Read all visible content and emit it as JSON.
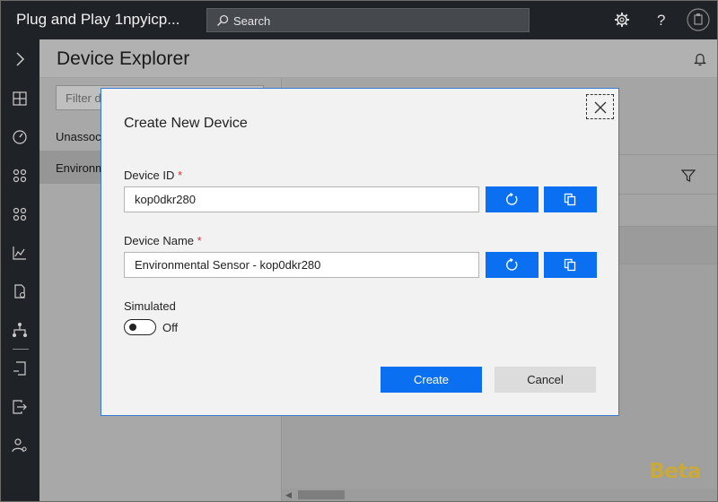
{
  "app": {
    "title": "Plug and Play 1npyicp..."
  },
  "search": {
    "placeholder": "Search"
  },
  "page": {
    "title": "Device Explorer"
  },
  "list": {
    "filter_placeholder": "Filter d",
    "items": [
      {
        "label": "Unassoci",
        "selected": false
      },
      {
        "label": "Environm",
        "selected": true
      }
    ]
  },
  "dialog": {
    "title": "Create New Device",
    "device_id": {
      "label": "Device ID",
      "required_mark": "*",
      "value": "kop0dkr280"
    },
    "device_name": {
      "label": "Device Name",
      "required_mark": "*",
      "value": "Environmental Sensor - kop0dkr280"
    },
    "simulated": {
      "label": "Simulated",
      "state": "Off"
    },
    "create_label": "Create",
    "cancel_label": "Cancel"
  },
  "badge": {
    "beta": "Beta"
  },
  "colors": {
    "accent": "#0a6ff0",
    "topbar": "#1f2226",
    "required": "#d13438",
    "beta": "#c9a93a"
  }
}
